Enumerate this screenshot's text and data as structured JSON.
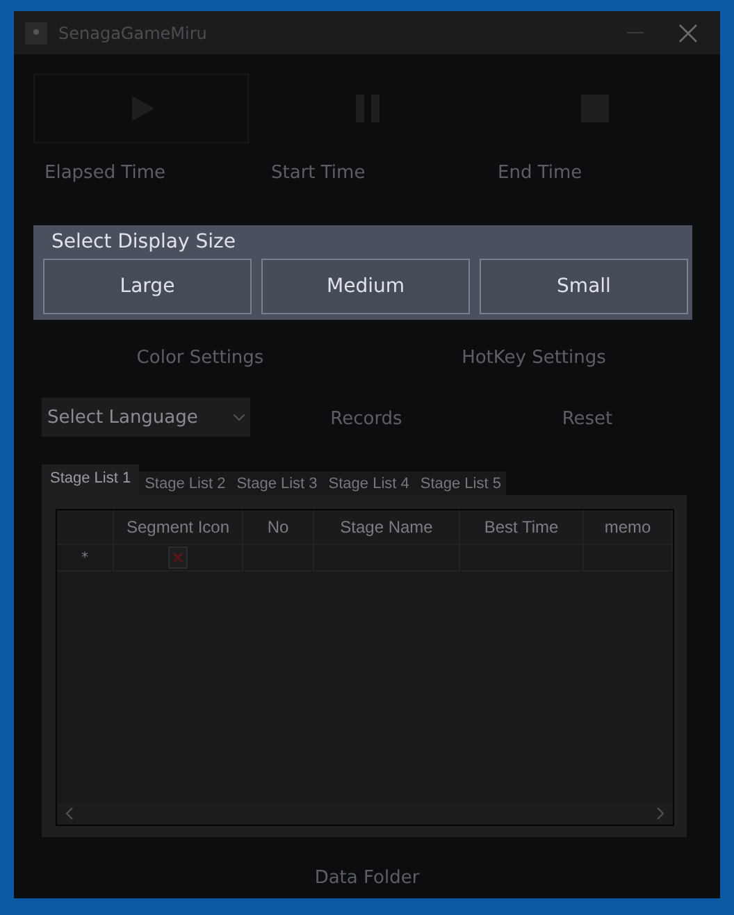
{
  "window": {
    "title": "SenagaGameMiru"
  },
  "transport": [
    {
      "kind": "play",
      "label": "Elapsed Time"
    },
    {
      "kind": "pause",
      "label": "Start Time"
    },
    {
      "kind": "stop",
      "label": "End Time"
    }
  ],
  "display_size_dialog": {
    "title": "Select Display Size",
    "options": [
      "Large",
      "Medium",
      "Small"
    ]
  },
  "settings_buttons": [
    "Color Settings",
    "HotKey Settings"
  ],
  "language_select": {
    "placeholder": "Select Language"
  },
  "action_buttons": [
    "Records",
    "Reset"
  ],
  "tabs": [
    {
      "label": "Stage List 1",
      "selected": true
    },
    {
      "label": "Stage List 2",
      "selected": false
    },
    {
      "label": "Stage List 3",
      "selected": false
    },
    {
      "label": "Stage List 4",
      "selected": false
    },
    {
      "label": "Stage List 5",
      "selected": false
    }
  ],
  "table": {
    "columns": [
      "Segment Icon",
      "No",
      "Stage Name",
      "Best Time",
      "memo"
    ],
    "new_row_marker": "*"
  },
  "footer_button": "Data Folder"
}
